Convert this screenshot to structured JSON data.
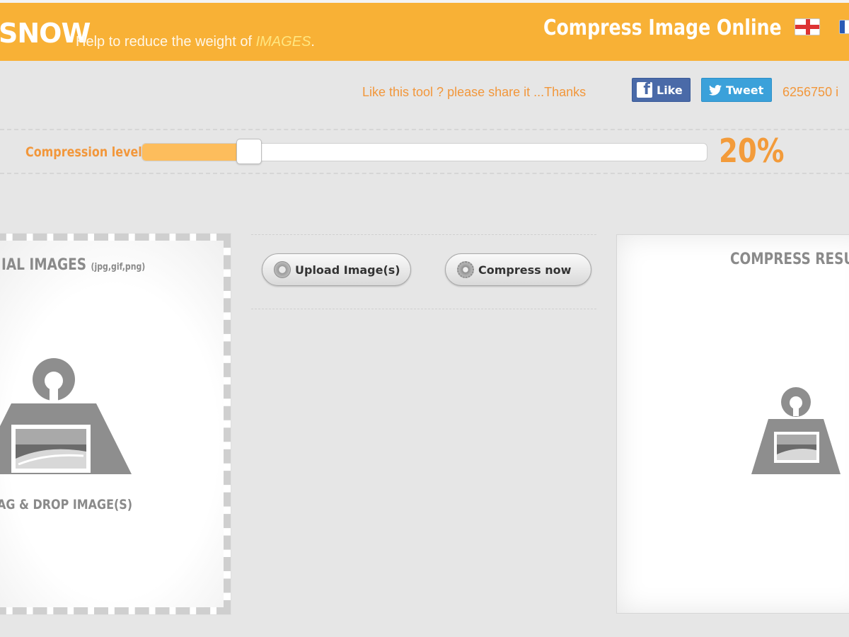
{
  "header": {
    "logo_fragment": "SNOW",
    "tagline_prefix": "Help to reduce the weight of ",
    "tagline_highlight": "IMAGES",
    "tagline_suffix": ".",
    "site_title": "Compress Image Online",
    "lang_icons": [
      "uk-flag-icon",
      "fr-flag-icon"
    ]
  },
  "share": {
    "prompt": "Like this tool ? please share it ...Thanks",
    "like_label": "Like",
    "tweet_label": "Tweet",
    "counter": "6256750 i"
  },
  "compression": {
    "label": "Compression level",
    "value_percent": 20,
    "value_text": "20%",
    "slider_fraction": 0.2
  },
  "left_panel": {
    "title": "IAL IMAGES",
    "title_types": "(jpg,gif,png)",
    "dropzone_label": "AG & DROP IMAGE(S)"
  },
  "actions": {
    "upload_label": "Upload Image(s)",
    "compress_label": "Compress now"
  },
  "right_panel": {
    "title": "COMPRESS RESU"
  },
  "colors": {
    "header_bg": "#f8b136",
    "accent_orange": "#f2973b",
    "facebook_blue": "#4a6aa8",
    "twitter_blue": "#3ba1da",
    "slider_fill": "#fdbd5c"
  }
}
